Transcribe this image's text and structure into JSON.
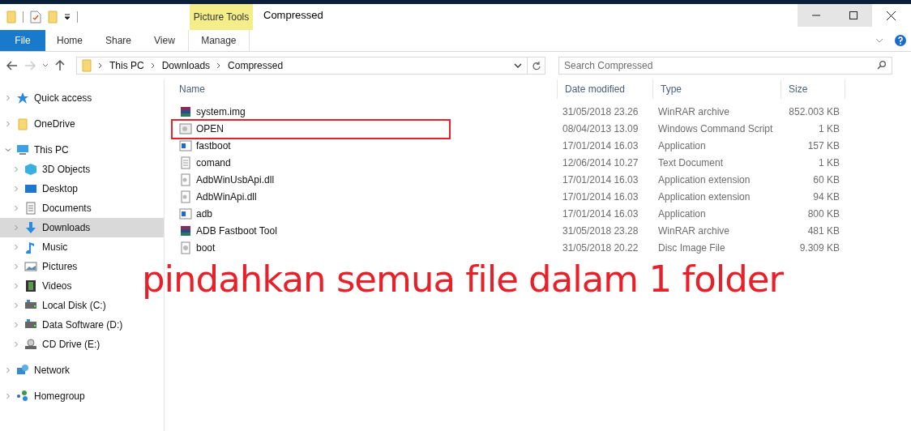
{
  "window": {
    "title": "Compressed",
    "context_group": "Picture Tools"
  },
  "ribbon_tabs": [
    {
      "label": "File",
      "kind": "file"
    },
    {
      "label": "Home",
      "kind": "tab"
    },
    {
      "label": "Share",
      "kind": "tab"
    },
    {
      "label": "View",
      "kind": "tab"
    },
    {
      "label": "Manage",
      "kind": "context"
    }
  ],
  "navigation": {
    "back_disabled": false,
    "forward_disabled": true
  },
  "address": {
    "path": [
      "This PC",
      "Downloads",
      "Compressed"
    ]
  },
  "search": {
    "placeholder": "Search Compressed"
  },
  "sidebar": {
    "items": [
      {
        "label": "Quick access",
        "kind": "star",
        "expanded": false,
        "selected": false
      },
      {
        "label": "OneDrive",
        "kind": "folder",
        "expanded": false,
        "selected": false
      },
      {
        "label": "This PC",
        "kind": "pc",
        "expanded": true,
        "selected": false,
        "children": [
          {
            "label": "3D Objects",
            "kind": "cube",
            "expanded": false,
            "selected": false
          },
          {
            "label": "Desktop",
            "kind": "desktop",
            "expanded": false,
            "selected": false
          },
          {
            "label": "Documents",
            "kind": "document",
            "expanded": false,
            "selected": false
          },
          {
            "label": "Downloads",
            "kind": "download",
            "expanded": false,
            "selected": true
          },
          {
            "label": "Music",
            "kind": "music",
            "expanded": false,
            "selected": false
          },
          {
            "label": "Pictures",
            "kind": "pictures",
            "expanded": false,
            "selected": false
          },
          {
            "label": "Videos",
            "kind": "videos",
            "expanded": false,
            "selected": false
          },
          {
            "label": "Local Disk (C:)",
            "kind": "drive",
            "expanded": false,
            "selected": false
          },
          {
            "label": "Data Software (D:)",
            "kind": "drive",
            "expanded": false,
            "selected": false
          },
          {
            "label": "CD Drive (E:)",
            "kind": "cd",
            "expanded": false,
            "selected": false
          }
        ]
      },
      {
        "label": "Network",
        "kind": "network",
        "expanded": false,
        "selected": false
      },
      {
        "label": "Homegroup",
        "kind": "homegroup",
        "expanded": false,
        "selected": false
      }
    ]
  },
  "table": {
    "columns": [
      "Name",
      "Date modified",
      "Type",
      "Size"
    ],
    "rows": [
      {
        "name": "system.img",
        "kind": "archive",
        "date": "31/05/2018 23.26",
        "type": "WinRAR archive",
        "size": "852.003 KB",
        "boxed": false
      },
      {
        "name": "OPEN",
        "kind": "script",
        "date": "08/04/2013 13.09",
        "type": "Windows Command Script",
        "size": "1 KB",
        "boxed": true
      },
      {
        "name": "fastboot",
        "kind": "app",
        "date": "17/01/2014 16.03",
        "type": "Application",
        "size": "157 KB",
        "boxed": false
      },
      {
        "name": "comand",
        "kind": "text",
        "date": "12/06/2014 10.27",
        "type": "Text Document",
        "size": "1 KB",
        "boxed": false
      },
      {
        "name": "AdbWinUsbApi.dll",
        "kind": "dll",
        "date": "17/01/2014 16.03",
        "type": "Application extension",
        "size": "60 KB",
        "boxed": false
      },
      {
        "name": "AdbWinApi.dll",
        "kind": "dll",
        "date": "17/01/2014 16.03",
        "type": "Application extension",
        "size": "94 KB",
        "boxed": false
      },
      {
        "name": "adb",
        "kind": "app",
        "date": "17/01/2014 16.03",
        "type": "Application",
        "size": "800 KB",
        "boxed": false
      },
      {
        "name": "ADB Fastboot Tool",
        "kind": "archive",
        "date": "31/05/2018 23.28",
        "type": "WinRAR archive",
        "size": "481 KB",
        "boxed": false
      },
      {
        "name": "boot",
        "kind": "disc",
        "date": "31/05/2018 20.22",
        "type": "Disc Image File",
        "size": "9.309 KB",
        "boxed": false
      }
    ]
  },
  "annotation": {
    "text": "pindahkan semua file dalam 1 folder"
  }
}
